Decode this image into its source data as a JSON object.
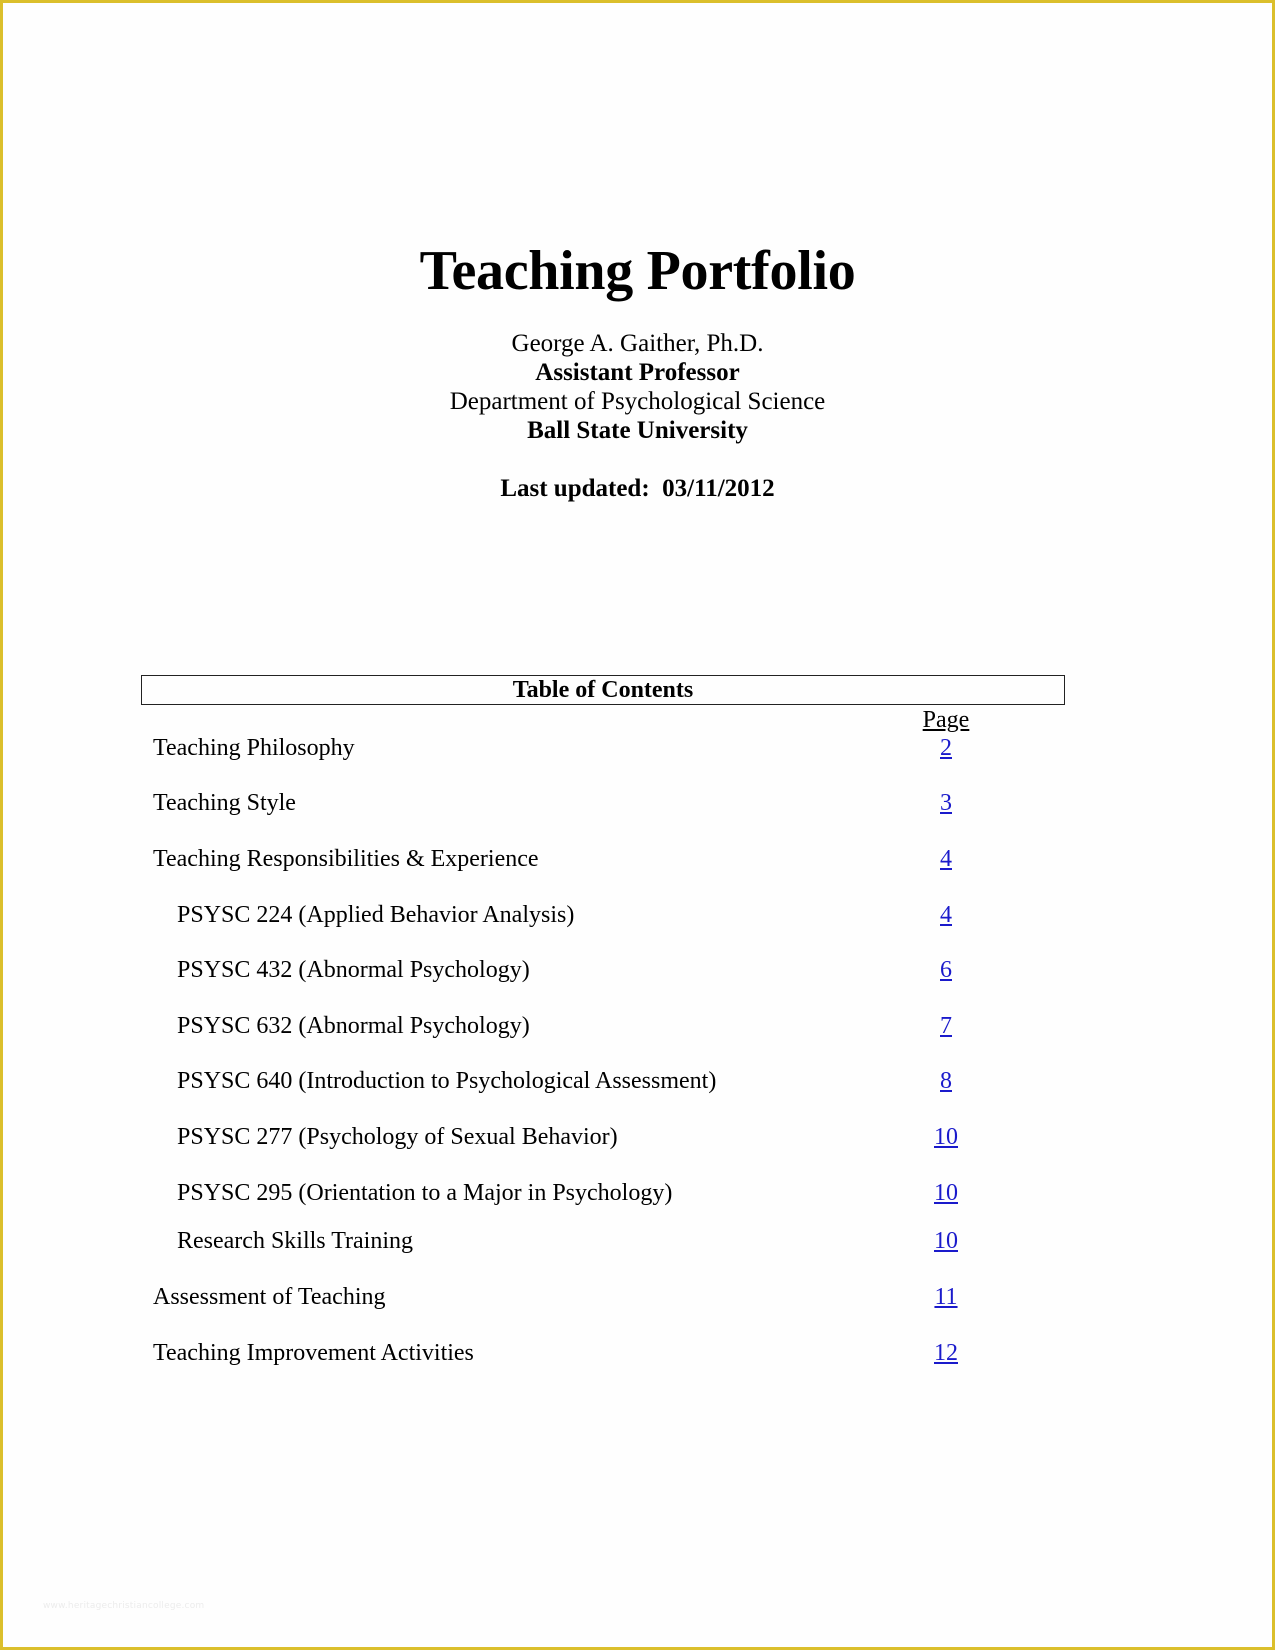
{
  "document": {
    "title": "Teaching Portfolio",
    "author": {
      "name": "George A. Gaither, Ph.D.",
      "position": "Assistant Professor",
      "department": "Department of Psychological Science",
      "institution": "Ball State University"
    },
    "last_updated": "Last updated:  03/11/2012",
    "border_color": "#dbbf2c",
    "link_color": "#1a1acb"
  },
  "toc": {
    "heading": "Table of Contents",
    "page_column_label": "Page",
    "entries": [
      {
        "label": "Teaching Philosophy",
        "page": "2",
        "level": 1
      },
      {
        "label": "Teaching Style",
        "page": "3",
        "level": 1
      },
      {
        "label": "Teaching Responsibilities & Experience",
        "page": "4",
        "level": 1
      },
      {
        "label": "PSYSC 224 (Applied Behavior Analysis)",
        "page": "4",
        "level": 2
      },
      {
        "label": "PSYSC 432 (Abnormal Psychology)",
        "page": "6",
        "level": 2
      },
      {
        "label": "PSYSC 632 (Abnormal Psychology)",
        "page": "7",
        "level": 2
      },
      {
        "label": "PSYSC 640 (Introduction to Psychological Assessment)",
        "page": "8",
        "level": 2
      },
      {
        "label": "PSYSC 277 (Psychology of Sexual Behavior)",
        "page": "10",
        "level": 2
      },
      {
        "label": "PSYSC 295 (Orientation to a Major in Psychology)",
        "page": "10",
        "level": 2
      },
      {
        "label": "Research Skills Training",
        "page": "10",
        "level": 2
      },
      {
        "label": "Assessment of Teaching",
        "page": "11",
        "level": 1
      },
      {
        "label": "Teaching Improvement Activities",
        "page": "12",
        "level": 1
      }
    ]
  },
  "watermark": "www.heritagechristiancollege.com"
}
